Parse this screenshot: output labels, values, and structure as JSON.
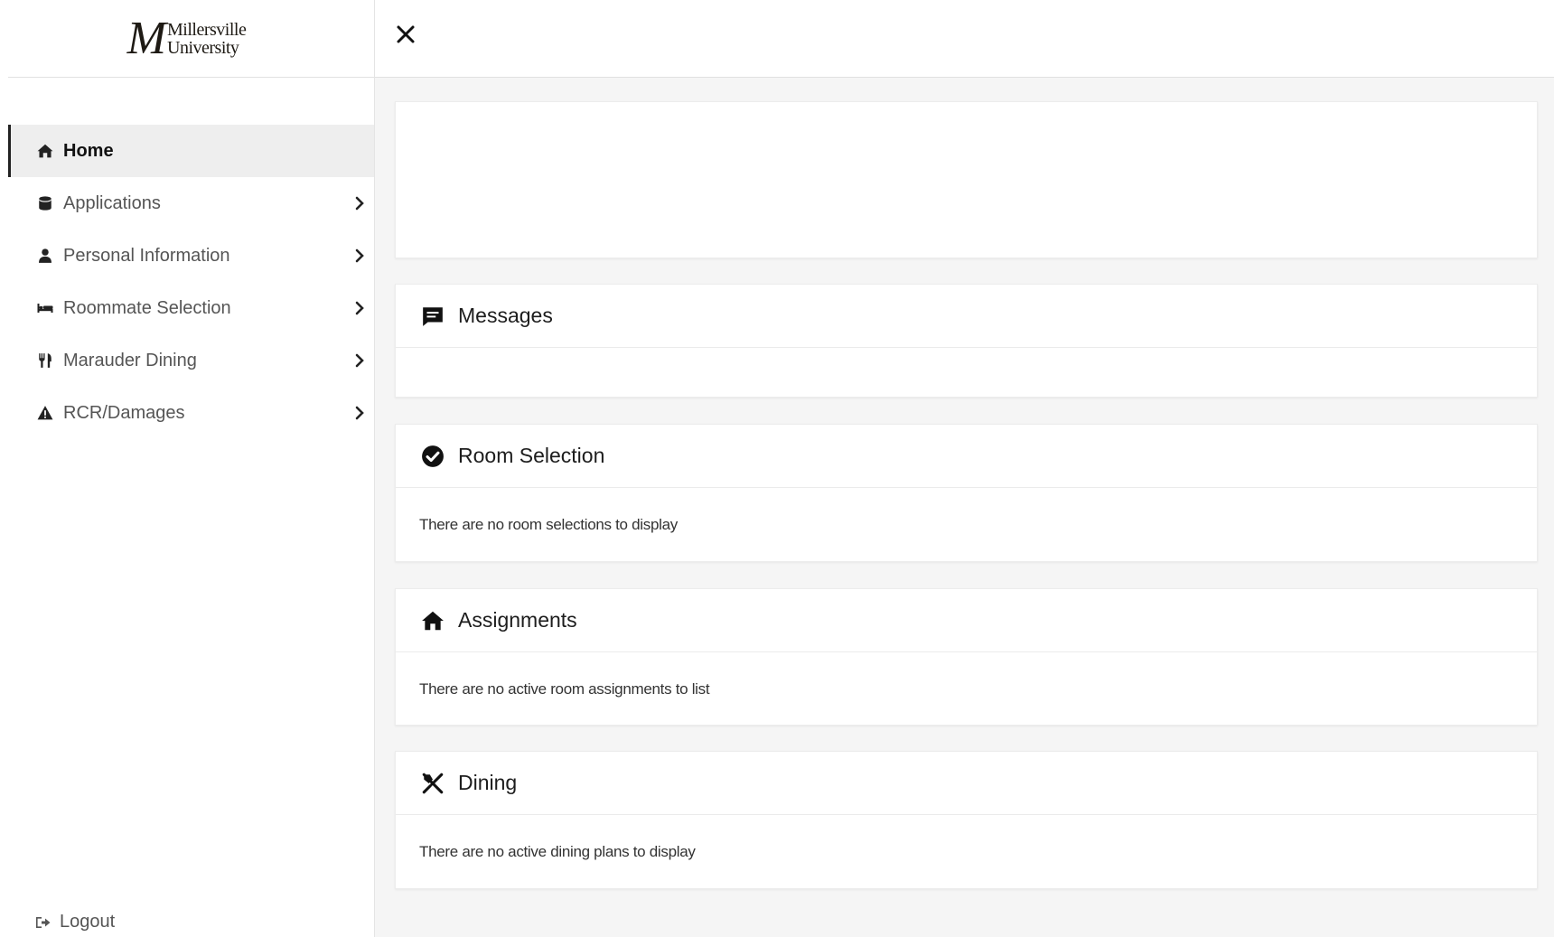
{
  "logo": {
    "mark": "M",
    "line1": "Millersville",
    "line2": "University"
  },
  "sidebar": {
    "items": [
      {
        "label": "Home",
        "icon": "home-icon",
        "active": true
      },
      {
        "label": "Applications",
        "icon": "database-icon"
      },
      {
        "label": "Personal Information",
        "icon": "user-icon"
      },
      {
        "label": "Roommate Selection",
        "icon": "bed-icon"
      },
      {
        "label": "Marauder Dining",
        "icon": "cutlery-icon"
      },
      {
        "label": "RCR/Damages",
        "icon": "warning-icon"
      }
    ],
    "logout_label": "Logout"
  },
  "main": {
    "cards": {
      "messages": {
        "title": "Messages",
        "body": ""
      },
      "room_selection": {
        "title": "Room Selection",
        "body": "There are no room selections to display"
      },
      "assignments": {
        "title": "Assignments",
        "body": "There are no active room assignments to list"
      },
      "dining": {
        "title": "Dining",
        "body": "There are no active dining plans to display"
      }
    }
  }
}
